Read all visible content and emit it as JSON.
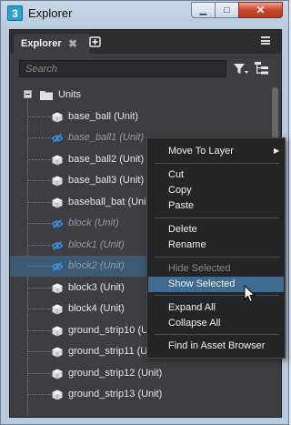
{
  "window": {
    "app_icon_text": "3",
    "title": "Explorer",
    "buttons": {
      "minimize": "▁",
      "maximize": "□",
      "close": "✕"
    }
  },
  "panel": {
    "tab_label": "Explorer",
    "tab_close": "✖",
    "add_tab": "+",
    "search_placeholder": "Search"
  },
  "tree": {
    "root_label": "Units",
    "items": [
      {
        "label": "base_ball (Unit)",
        "visible": true
      },
      {
        "label": "base_ball1 (Unit)",
        "visible": false
      },
      {
        "label": "base_ball2 (Unit)",
        "visible": true
      },
      {
        "label": "base_ball3 (Unit)",
        "visible": true
      },
      {
        "label": "baseball_bat (Unit)",
        "visible": true
      },
      {
        "label": "block (Unit)",
        "visible": false
      },
      {
        "label": "block1 (Unit)",
        "visible": false
      },
      {
        "label": "block2 (Unit)",
        "visible": false,
        "selected": true
      },
      {
        "label": "block3 (Unit)",
        "visible": true
      },
      {
        "label": "block4 (Unit)",
        "visible": true
      },
      {
        "label": "ground_strip10 (Unit)",
        "visible": true
      },
      {
        "label": "ground_strip11 (Unit)",
        "visible": true
      },
      {
        "label": "ground_strip12 (Unit)",
        "visible": true
      },
      {
        "label": "ground_strip13 (Unit)",
        "visible": true
      }
    ]
  },
  "context_menu": {
    "items": [
      {
        "label": "Move To Layer",
        "submenu": true
      },
      {
        "label": "Cut"
      },
      {
        "label": "Copy"
      },
      {
        "label": "Paste"
      },
      {
        "label": "Delete"
      },
      {
        "label": "Rename"
      },
      {
        "label": "Hide Selected",
        "disabled": true
      },
      {
        "label": "Show Selected",
        "hover": true
      },
      {
        "label": "Expand All"
      },
      {
        "label": "Collapse All"
      },
      {
        "label": "Find in Asset Browser"
      }
    ]
  },
  "colors": {
    "selection": "#3a5a75",
    "menu_hover": "#3e6b8f",
    "panel_bg": "#3e3e42",
    "eye_icon": "#3b8ee0"
  }
}
